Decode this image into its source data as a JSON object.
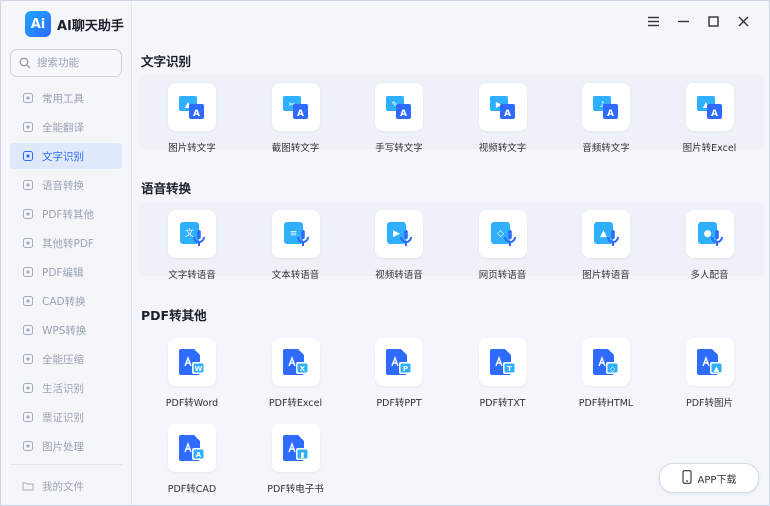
{
  "app": {
    "logo_text": "Ai",
    "title": "AI聊天助手"
  },
  "search": {
    "placeholder": "搜索功能"
  },
  "sidebar": {
    "items": [
      {
        "label": "常用工具",
        "icon": "grid-icon",
        "active": false
      },
      {
        "label": "全能翻译",
        "icon": "translate-icon",
        "active": false
      },
      {
        "label": "文字识别",
        "icon": "ocr-icon",
        "active": true
      },
      {
        "label": "语音转换",
        "icon": "voice-icon",
        "active": false
      },
      {
        "label": "PDF转其他",
        "icon": "pdf-out-icon",
        "active": false
      },
      {
        "label": "其他转PDF",
        "icon": "pdf-in-icon",
        "active": false
      },
      {
        "label": "PDF编辑",
        "icon": "pdf-edit-icon",
        "active": false
      },
      {
        "label": "CAD转换",
        "icon": "cad-icon",
        "active": false
      },
      {
        "label": "WPS转换",
        "icon": "wps-icon",
        "active": false
      },
      {
        "label": "全能压缩",
        "icon": "compress-icon",
        "active": false
      },
      {
        "label": "生活识别",
        "icon": "life-scan-icon",
        "active": false
      },
      {
        "label": "票证识别",
        "icon": "ticket-icon",
        "active": false
      },
      {
        "label": "图片处理",
        "icon": "image-icon",
        "active": false
      }
    ],
    "bottom_item": {
      "label": "我的文件",
      "icon": "folder-icon"
    }
  },
  "sections": {
    "ocr": {
      "title": "文字识别",
      "tools": [
        "图片转文字",
        "截图转文字",
        "手写转文字",
        "视频转文字",
        "音频转文字",
        "图片转Excel"
      ]
    },
    "voice": {
      "title": "语音转换",
      "tools": [
        "文字转语音",
        "文本转语音",
        "视频转语音",
        "网页转语音",
        "图片转语音",
        "多人配音"
      ]
    },
    "pdf": {
      "title": "PDF转其他",
      "tools": [
        "PDF转Word",
        "PDF转Excel",
        "PDF转PPT",
        "PDF转TXT",
        "PDF转HTML",
        "PDF转图片",
        "PDF转CAD",
        "PDF转电子书"
      ]
    }
  },
  "app_download": {
    "label": "APP下载"
  },
  "colors": {
    "accent": "#2f6bff",
    "icon_light": "#2eb0ff",
    "icon_dark": "#2f6bff"
  }
}
